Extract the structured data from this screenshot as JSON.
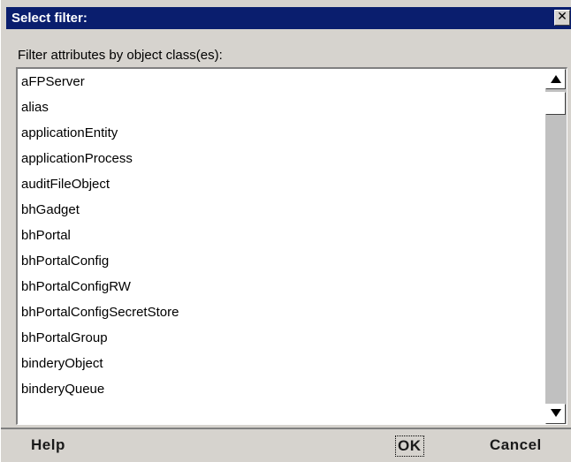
{
  "dialog": {
    "title": "Select filter:",
    "close_glyph": "✕",
    "filter_label": "Filter attributes by object class(es):",
    "object_classes": [
      "aFPServer",
      "alias",
      "applicationEntity",
      "applicationProcess",
      "auditFileObject",
      "bhGadget",
      "bhPortal",
      "bhPortalConfig",
      "bhPortalConfigRW",
      "bhPortalConfigSecretStore",
      "bhPortalGroup",
      "binderyObject",
      "binderyQueue"
    ],
    "buttons": {
      "help": "Help",
      "ok": "OK",
      "cancel": "Cancel"
    }
  },
  "colors": {
    "titlebar": "#0a1e6e",
    "dialog_bg": "#d6d3ce",
    "list_bg": "#ffffff"
  },
  "icons": {
    "close": "close-icon",
    "scroll_up": "scroll-up-arrow-icon",
    "scroll_down": "scroll-down-arrow-icon"
  }
}
